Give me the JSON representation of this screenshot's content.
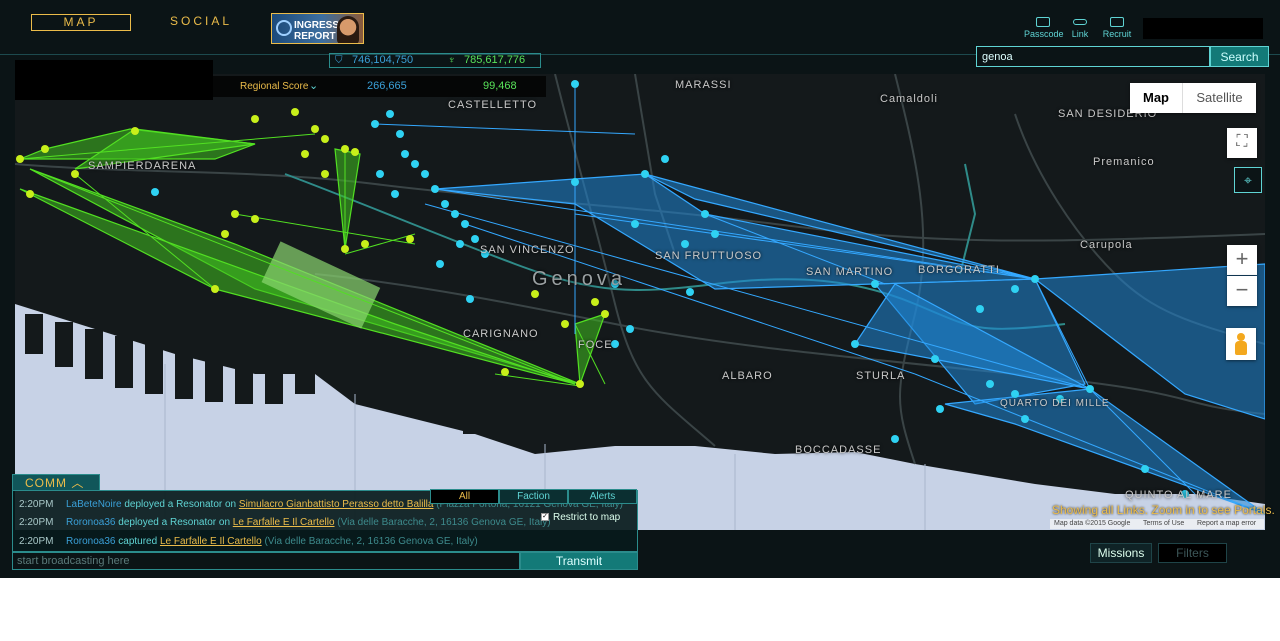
{
  "nav": {
    "map": "MAP",
    "social": "SOCIAL",
    "report_line1": "INGRESS",
    "report_line2": "REPORT"
  },
  "global_score": {
    "enlightened": "746,104,750",
    "resistance": "785,617,776"
  },
  "tools": {
    "passcode": "Passcode",
    "link": "Link",
    "recruit": "Recruit"
  },
  "search": {
    "value": "genoa",
    "button": "Search"
  },
  "regional": {
    "label": "Regional Score",
    "enlightened": "266,665",
    "resistance": "99,468"
  },
  "map_type": {
    "map": "Map",
    "satellite": "Satellite"
  },
  "map_labels": [
    "MARASSI",
    "CASTELLETTO",
    "Camaldoli",
    "SAN DESIDERIO",
    "Premanico",
    "SAMPIERDARENA",
    "SAN VINCENZO",
    "SAN FRUTTUOSO",
    "SAN MARTINO",
    "BORGORATTI",
    "Carupola",
    "Genova",
    "CARIGNANO",
    "FOCE",
    "ALBARO",
    "STURLA",
    "BOCCADASSE",
    "QUINTO AL MARE",
    "QUARTO DEI MILLE"
  ],
  "map_notice": "Showing all Links. Zoom in to see Portals.",
  "attribution": {
    "data": "Map data ©2015 Google",
    "terms": "Terms of Use",
    "report": "Report a map error"
  },
  "comm": {
    "title": "COMM",
    "tabs": [
      "All",
      "Faction",
      "Alerts"
    ],
    "restrict": "Restrict to map",
    "messages": [
      {
        "time": "2:20PM",
        "agent": "LaBeteNoire",
        "action": " deployed a Resonator on ",
        "portal": "Simulacro Gianbattisto Perasso detto Balilla",
        "address": " (Piazza Portoria, 16121 Genova GE, Italy)"
      },
      {
        "time": "2:20PM",
        "agent": "Roronoa36",
        "action": " deployed a Resonator on ",
        "portal": "Le Farfalle E Il Cartello",
        "address": " (Via delle Baracche, 2, 16136 Genova GE, Italy)"
      },
      {
        "time": "2:20PM",
        "agent": "Roronoa36",
        "action": " captured ",
        "portal": "Le Farfalle E Il Cartello",
        "address": " (Via delle Baracche, 2, 16136 Genova GE, Italy)"
      }
    ],
    "broadcast_placeholder": "start broadcasting here",
    "transmit": "Transmit"
  },
  "bottom": {
    "missions": "Missions",
    "filters": "Filters"
  },
  "colors": {
    "enlightened": "#59e35a",
    "resistance": "#3aa0d8",
    "accent": "#ebbc4a",
    "ui": "#5fd4d4"
  }
}
